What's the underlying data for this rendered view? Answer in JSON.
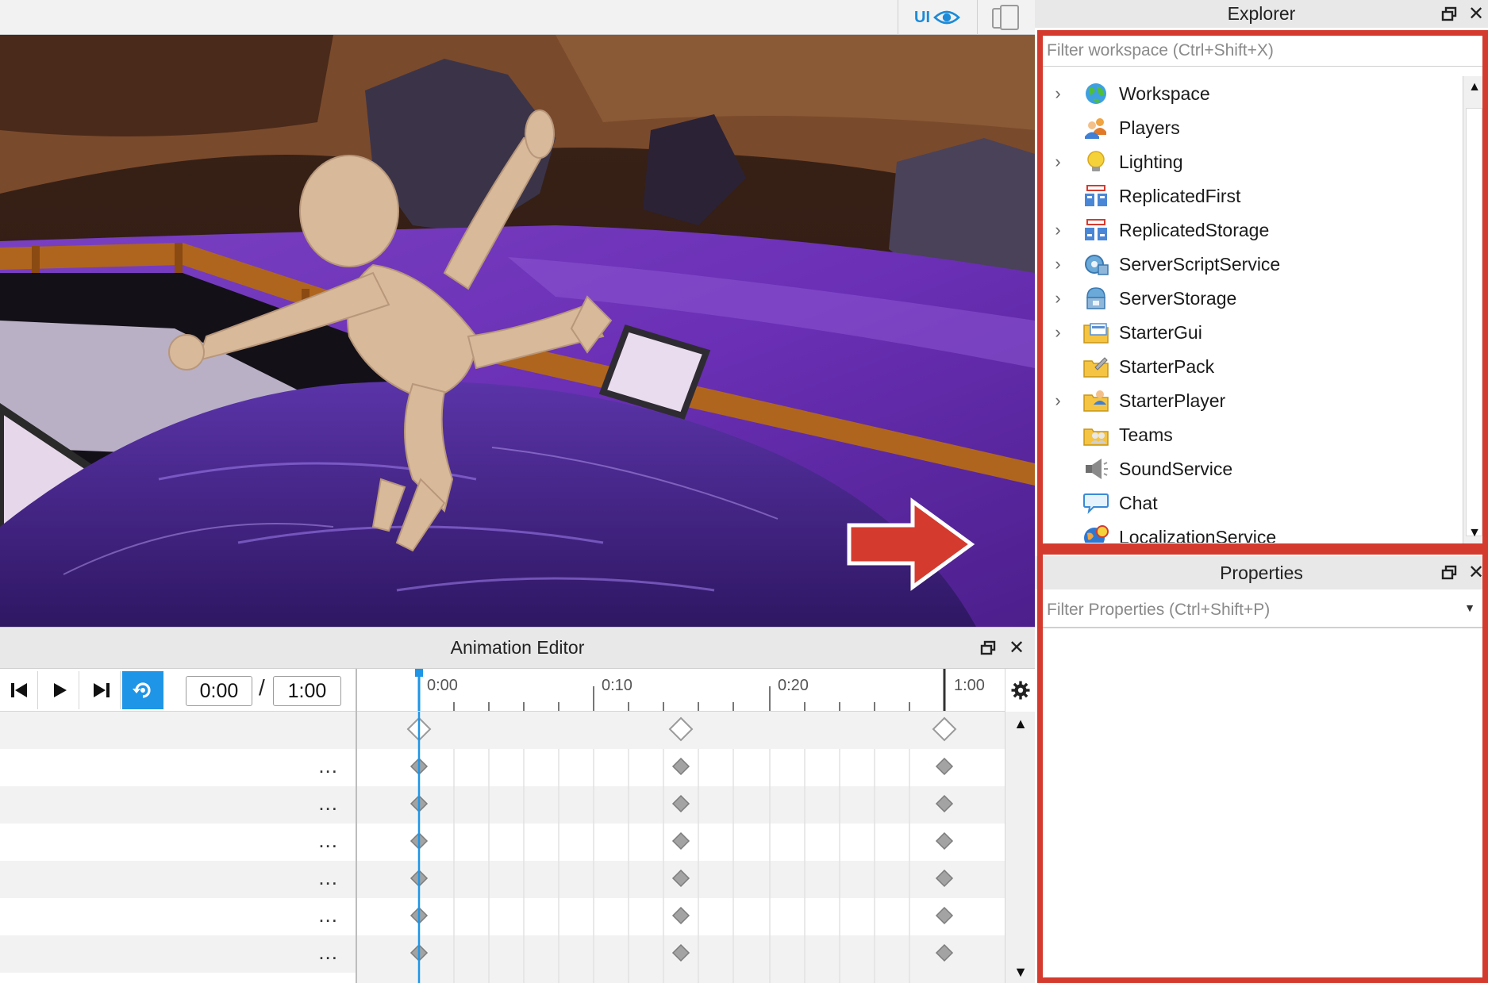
{
  "toolbar": {
    "ui_toggle_label": "UI"
  },
  "explorer": {
    "title": "Explorer",
    "filter_placeholder": "Filter workspace (Ctrl+Shift+X)",
    "items": [
      {
        "label": "Workspace",
        "icon": "globe-icon",
        "expandable": true
      },
      {
        "label": "Players",
        "icon": "players-icon",
        "expandable": false
      },
      {
        "label": "Lighting",
        "icon": "lightbulb-icon",
        "expandable": true
      },
      {
        "label": "ReplicatedFirst",
        "icon": "replicated-first-icon",
        "expandable": false
      },
      {
        "label": "ReplicatedStorage",
        "icon": "replicated-storage-icon",
        "expandable": true
      },
      {
        "label": "ServerScriptService",
        "icon": "server-script-service-icon",
        "expandable": true
      },
      {
        "label": "ServerStorage",
        "icon": "server-storage-icon",
        "expandable": true
      },
      {
        "label": "StarterGui",
        "icon": "starter-gui-icon",
        "expandable": true
      },
      {
        "label": "StarterPack",
        "icon": "starter-pack-icon",
        "expandable": false
      },
      {
        "label": "StarterPlayer",
        "icon": "starter-player-icon",
        "expandable": true
      },
      {
        "label": "Teams",
        "icon": "teams-icon",
        "expandable": false
      },
      {
        "label": "SoundService",
        "icon": "speaker-icon",
        "expandable": false
      },
      {
        "label": "Chat",
        "icon": "chat-bubble-icon",
        "expandable": false
      },
      {
        "label": "LocalizationService",
        "icon": "localization-icon",
        "expandable": false
      }
    ]
  },
  "properties": {
    "title": "Properties",
    "filter_placeholder": "Filter Properties (Ctrl+Shift+P)"
  },
  "animation_editor": {
    "title": "Animation Editor",
    "current_time": "0:00",
    "separator": "/",
    "end_time": "1:00",
    "ruler_labels": [
      "0:00",
      "0:10",
      "0:20",
      "1:00"
    ],
    "track_menu": "...",
    "track_count": 6,
    "loop_enabled": true
  },
  "colors": {
    "accent_blue": "#1e95e6",
    "highlight_red": "#d53a2e",
    "keyframe_gray": "#9a9a9a"
  }
}
